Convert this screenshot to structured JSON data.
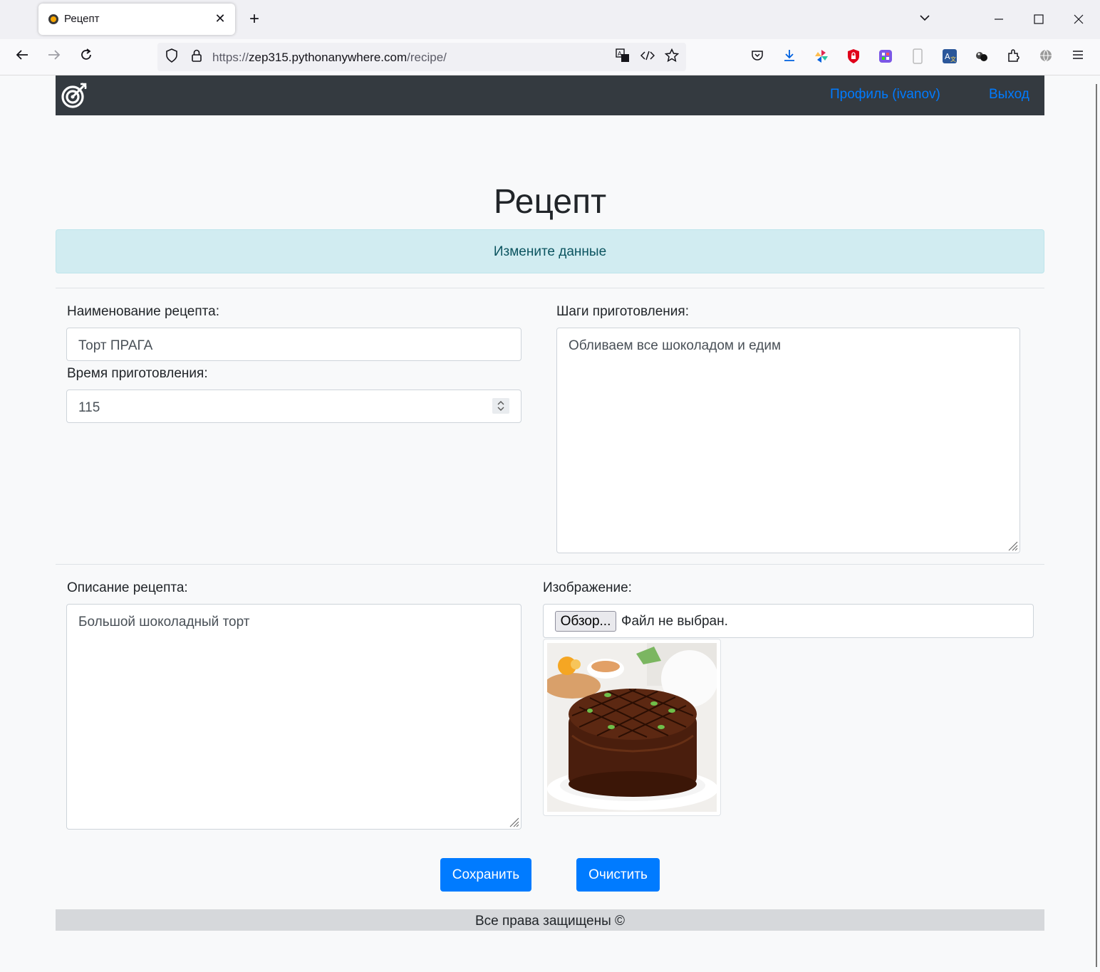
{
  "browser": {
    "tab_title": "Рецепт",
    "tab_close": "✕",
    "new_tab": "+",
    "url_scheme": "https://",
    "url_host": "zep315.pythonanywhere.com",
    "url_path": "/recipe/"
  },
  "site": {
    "nav": {
      "profile_link": "Профиль (ivanov)",
      "logout_link": "Выход"
    },
    "page_title": "Рецепт",
    "alert_text": "Измените данные",
    "form": {
      "name_label": "Наименование рецепта:",
      "name_value": "Торт ПРАГА",
      "time_label": "Время приготовления:",
      "time_value": "115",
      "steps_label": "Шаги приготовления:",
      "steps_value": "Обливаем все шоколадом и едим",
      "description_label": "Описание рецепта:",
      "description_value": "Большой шоколадный торт",
      "image_label": "Изображение:",
      "browse_button": "Обзор...",
      "no_file_text": "Файл не выбран."
    },
    "buttons": {
      "save": "Сохранить",
      "clear": "Очистить"
    },
    "footer_text": "Все права защищены ©"
  },
  "colors": {
    "navbar_bg": "#343a40",
    "link": "#007bff",
    "alert_bg": "#d1ecf1",
    "alert_text": "#0c5460",
    "button_bg": "#007bff",
    "footer_bg": "#d6d8db"
  }
}
